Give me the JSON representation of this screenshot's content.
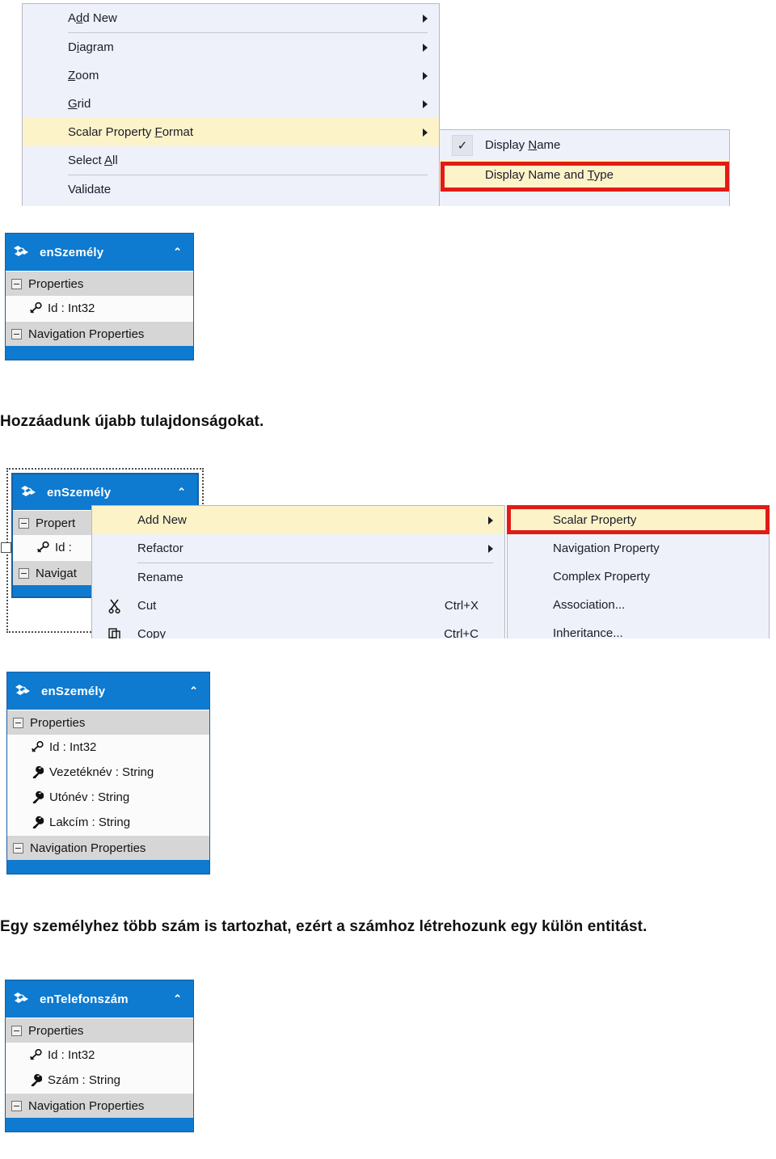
{
  "document": {
    "paragraphs": [
      {
        "id": "p1",
        "text": "Hozzáadunk újabb tulajdonságokat.",
        "bold": true
      },
      {
        "id": "p2",
        "text": "Egy személyhez több szám is tartozhat, ezért a számhoz létrehozunk egy külön entitást.",
        "bold": true
      }
    ]
  },
  "colors": {
    "entity_header": "#0e7ad0",
    "entity_border": "#1a5fa0",
    "section_row": "#d6d6d6",
    "menu_bg": "#eef1f9",
    "menu_highlight": "#fdf3c9",
    "red_highlight": "#e21b16"
  },
  "figure1": {
    "name": "diagram-context-menu",
    "menu": {
      "items": [
        {
          "label": "Add New",
          "underline": "d",
          "submenu": true,
          "highlighted": false,
          "separator_after": true
        },
        {
          "label": "Diagram",
          "underline": "i",
          "submenu": true,
          "highlighted": false,
          "separator_after": false
        },
        {
          "label": "Zoom",
          "underline": "Z",
          "submenu": true,
          "highlighted": false,
          "separator_after": false
        },
        {
          "label": "Grid",
          "underline": "G",
          "submenu": true,
          "highlighted": false,
          "separator_after": false
        },
        {
          "label": "Scalar Property Format",
          "underline": "F",
          "submenu": true,
          "highlighted": true,
          "separator_after": false
        },
        {
          "label": "Select All",
          "underline": "A",
          "submenu": false,
          "highlighted": false,
          "separator_after": true
        },
        {
          "label": "Validate",
          "underline": "",
          "submenu": false,
          "highlighted": false,
          "separator_after": false
        }
      ]
    },
    "submenu": {
      "name": "scalar-property-format-submenu",
      "items": [
        {
          "label": "Display Name",
          "underline": "N",
          "checked": true,
          "highlighted": false
        },
        {
          "label": "Display Name and Type",
          "underline": "T",
          "checked": false,
          "highlighted": true
        }
      ]
    },
    "checkmark_glyph": "✓"
  },
  "figure2": {
    "name": "entity-enszemely-initial",
    "entity": {
      "title": "enSzemély",
      "icon": "entity-icon",
      "collapse_glyph": "⌃",
      "sections": [
        {
          "label": "Properties",
          "properties": [
            {
              "name": "Id",
              "type": "Int32",
              "text": "Id : Int32",
              "icon": "key-icon"
            }
          ]
        },
        {
          "label": "Navigation Properties",
          "properties": []
        }
      ]
    }
  },
  "figure3": {
    "name": "entity-add-new-context-menu",
    "entity": {
      "title": "enSzemély",
      "icon": "entity-icon",
      "collapse_glyph": "⌃",
      "sections": [
        {
          "label": "Propert",
          "properties": [
            {
              "text": "Id :",
              "icon": "key-icon"
            }
          ]
        },
        {
          "label": "Navigat",
          "properties": []
        }
      ]
    },
    "menu": {
      "items": [
        {
          "label": "Add New",
          "accel": "",
          "icon": "",
          "submenu": true,
          "highlighted": true,
          "separator_after": false
        },
        {
          "label": "Refactor",
          "accel": "",
          "icon": "",
          "submenu": true,
          "highlighted": false,
          "separator_after": true
        },
        {
          "label": "Rename",
          "accel": "",
          "icon": "",
          "submenu": false,
          "highlighted": false,
          "separator_after": false
        },
        {
          "label": "Cut",
          "accel": "Ctrl+X",
          "icon": "scissors-icon",
          "submenu": false,
          "highlighted": false,
          "separator_after": false
        },
        {
          "label": "Copy",
          "accel": "Ctrl+C",
          "icon": "copy-icon",
          "submenu": false,
          "highlighted": false,
          "separator_after": false
        }
      ]
    },
    "submenu": {
      "name": "add-new-submenu",
      "items": [
        {
          "label": "Scalar Property",
          "highlighted": true
        },
        {
          "label": "Navigation Property",
          "highlighted": false
        },
        {
          "label": "Complex Property",
          "highlighted": false
        },
        {
          "label": "Association...",
          "highlighted": false
        },
        {
          "label": "Inheritance...",
          "highlighted": false
        }
      ]
    }
  },
  "figure4": {
    "name": "entity-enszemely-expanded",
    "entity": {
      "title": "enSzemély",
      "icon": "entity-icon",
      "collapse_glyph": "⌃",
      "sections": [
        {
          "label": "Properties",
          "properties": [
            {
              "name": "Id",
              "type": "Int32",
              "text": "Id : Int32",
              "icon": "key-icon"
            },
            {
              "name": "Vezetéknév",
              "type": "String",
              "text": "Vezetéknév : String",
              "icon": "wrench-icon"
            },
            {
              "name": "Utónév",
              "type": "String",
              "text": "Utónév : String",
              "icon": "wrench-icon"
            },
            {
              "name": "Lakcím",
              "type": "String",
              "text": "Lakcím : String",
              "icon": "wrench-icon"
            }
          ]
        },
        {
          "label": "Navigation Properties",
          "properties": []
        }
      ]
    }
  },
  "figure5": {
    "name": "entity-entelefonszam",
    "entity": {
      "title": "enTelefonszám",
      "icon": "entity-icon",
      "collapse_glyph": "⌃",
      "sections": [
        {
          "label": "Properties",
          "properties": [
            {
              "name": "Id",
              "type": "Int32",
              "text": "Id : Int32",
              "icon": "key-icon"
            },
            {
              "name": "Szám",
              "type": "String",
              "text": "Szám : String",
              "icon": "wrench-icon"
            }
          ]
        },
        {
          "label": "Navigation Properties",
          "properties": []
        }
      ]
    }
  }
}
